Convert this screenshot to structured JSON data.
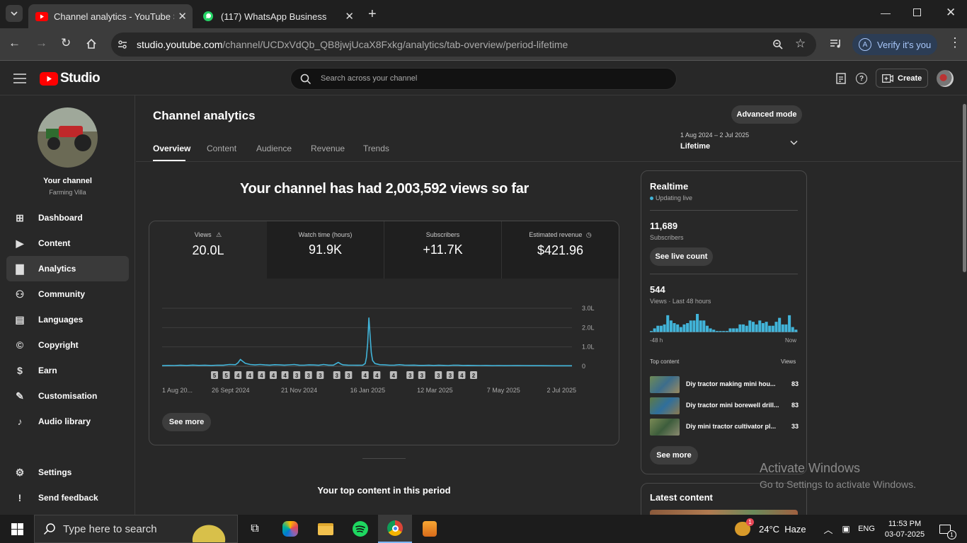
{
  "browser": {
    "tabs": [
      {
        "title": "Channel analytics - YouTube Stu",
        "active": true
      },
      {
        "title": "(117) WhatsApp Business",
        "active": false
      }
    ],
    "url_host": "studio.youtube.com",
    "url_path": "/channel/UCDxVdQb_QB8jwjUcaX8Fxkg/analytics/tab-overview/period-lifetime",
    "verify_label": "Verify it's you",
    "profile_letter": "A"
  },
  "header": {
    "logo_text": "Studio",
    "search_placeholder": "Search across your channel",
    "create_label": "Create"
  },
  "sidebar": {
    "channel_title": "Your channel",
    "channel_name": "Farming Villa",
    "items": [
      {
        "label": "Dashboard",
        "icon": "dashboard-icon",
        "active": false
      },
      {
        "label": "Content",
        "icon": "content-icon",
        "active": false
      },
      {
        "label": "Analytics",
        "icon": "analytics-icon",
        "active": true
      },
      {
        "label": "Community",
        "icon": "community-icon",
        "active": false
      },
      {
        "label": "Languages",
        "icon": "languages-icon",
        "active": false
      },
      {
        "label": "Copyright",
        "icon": "copyright-icon",
        "active": false
      },
      {
        "label": "Earn",
        "icon": "earn-icon",
        "active": false
      },
      {
        "label": "Customisation",
        "icon": "customisation-icon",
        "active": false
      },
      {
        "label": "Audio library",
        "icon": "audio-library-icon",
        "active": false
      }
    ],
    "bottom_items": [
      {
        "label": "Settings",
        "icon": "settings-icon"
      },
      {
        "label": "Send feedback",
        "icon": "feedback-icon"
      }
    ]
  },
  "main": {
    "page_title": "Channel analytics",
    "advanced_mode_label": "Advanced mode",
    "tabs": [
      "Overview",
      "Content",
      "Audience",
      "Revenue",
      "Trends"
    ],
    "active_tab": "Overview",
    "period": {
      "range": "1 Aug 2024 – 2 Jul 2025",
      "label": "Lifetime"
    },
    "headline": "Your channel has had 2,003,592 views so far",
    "metrics": [
      {
        "label": "Views",
        "value": "20.0L",
        "icon": "warning-icon"
      },
      {
        "label": "Watch time (hours)",
        "value": "91.9K",
        "icon": ""
      },
      {
        "label": "Subscribers",
        "value": "+11.7K",
        "icon": ""
      },
      {
        "label": "Estimated revenue",
        "value": "$421.96",
        "icon": "clock-icon"
      }
    ],
    "see_more_label": "See more",
    "top_content_heading": "Your top content in this period"
  },
  "chart_data": {
    "type": "line",
    "ylabel": "",
    "yticks": [
      "0",
      "1.0L",
      "2.0L",
      "3.0L"
    ],
    "ylim": [
      0,
      300000
    ],
    "xticks": [
      {
        "label": "1 Aug 20...",
        "day": 0
      },
      {
        "label": "26 Sept 2024",
        "day": 56
      },
      {
        "label": "21 Nov 2024",
        "day": 112
      },
      {
        "label": "16 Jan 2025",
        "day": 168
      },
      {
        "label": "12 Mar 2025",
        "day": 223
      },
      {
        "label": "7 May 2025",
        "day": 279
      },
      {
        "label": "2 Jul 2025",
        "day": 335
      }
    ],
    "series": [
      {
        "values": [
          [
            0,
            3000
          ],
          [
            5,
            4000
          ],
          [
            10,
            3500
          ],
          [
            15,
            5000
          ],
          [
            20,
            4000
          ],
          [
            25,
            6000
          ],
          [
            30,
            4500
          ],
          [
            35,
            5000
          ],
          [
            40,
            4000
          ],
          [
            45,
            5500
          ],
          [
            50,
            5000
          ],
          [
            55,
            9000
          ],
          [
            60,
            8000
          ],
          [
            62,
            18000
          ],
          [
            64,
            35000
          ],
          [
            66,
            25000
          ],
          [
            68,
            15000
          ],
          [
            72,
            9000
          ],
          [
            76,
            7000
          ],
          [
            80,
            9000
          ],
          [
            84,
            7000
          ],
          [
            88,
            6000
          ],
          [
            92,
            8000
          ],
          [
            96,
            7000
          ],
          [
            100,
            6000
          ],
          [
            104,
            7500
          ],
          [
            108,
            9000
          ],
          [
            112,
            6000
          ],
          [
            116,
            5500
          ],
          [
            120,
            7000
          ],
          [
            124,
            6500
          ],
          [
            128,
            5000
          ],
          [
            132,
            9000
          ],
          [
            136,
            6000
          ],
          [
            140,
            6000
          ],
          [
            144,
            20000
          ],
          [
            146,
            12000
          ],
          [
            148,
            7000
          ],
          [
            152,
            6000
          ],
          [
            156,
            5500
          ],
          [
            160,
            5000
          ],
          [
            164,
            6000
          ],
          [
            166,
            14000
          ],
          [
            167,
            45000
          ],
          [
            168,
            120000
          ],
          [
            169,
            250000
          ],
          [
            170,
            160000
          ],
          [
            171,
            70000
          ],
          [
            172,
            30000
          ],
          [
            174,
            14000
          ],
          [
            178,
            8000
          ],
          [
            182,
            7000
          ],
          [
            186,
            5500
          ],
          [
            190,
            6000
          ],
          [
            194,
            8000
          ],
          [
            198,
            6000
          ],
          [
            202,
            5000
          ],
          [
            206,
            6000
          ],
          [
            210,
            4500
          ],
          [
            214,
            4500
          ],
          [
            218,
            5000
          ],
          [
            222,
            4000
          ],
          [
            226,
            5000
          ],
          [
            230,
            4500
          ],
          [
            234,
            3500
          ],
          [
            238,
            5500
          ],
          [
            242,
            5000
          ],
          [
            246,
            4000
          ],
          [
            250,
            4500
          ],
          [
            255,
            4000
          ],
          [
            260,
            3500
          ],
          [
            265,
            4000
          ],
          [
            270,
            3000
          ],
          [
            275,
            3500
          ],
          [
            280,
            3000
          ],
          [
            290,
            3500
          ],
          [
            300,
            3000
          ],
          [
            310,
            3000
          ],
          [
            320,
            2500
          ],
          [
            335,
            2500
          ]
        ]
      }
    ],
    "markers": [
      "5",
      "5",
      "4",
      "4",
      "4",
      "4",
      "4",
      "3",
      "3",
      "3",
      "3",
      "3",
      "4",
      "4",
      "4",
      "3",
      "3",
      "3",
      "3",
      "4",
      "2"
    ],
    "grid": true
  },
  "realtime": {
    "title": "Realtime",
    "status": "Updating live",
    "subscribers_value": "11,689",
    "subscribers_label": "Subscribers",
    "see_live_count_label": "See live count",
    "views_value": "544",
    "views_label": "Views · Last 48 hours",
    "axis_start": "-48 h",
    "axis_end": "Now",
    "bars": [
      1,
      3,
      5,
      5,
      6,
      13,
      9,
      7,
      6,
      4,
      6,
      7,
      9,
      9,
      14,
      9,
      9,
      5,
      3,
      2,
      1,
      1,
      1,
      1,
      3,
      3,
      3,
      6,
      6,
      5,
      9,
      8,
      6,
      9,
      7,
      8,
      5,
      5,
      8,
      11,
      6,
      6,
      13,
      4,
      2
    ],
    "top_content_label": "Top content",
    "views_col_label": "Views",
    "top_content": [
      {
        "title": "Diy tractor making mini hou...",
        "views": "83"
      },
      {
        "title": "Diy tractor mini borewell drill...",
        "views": "83"
      },
      {
        "title": "Diy mini tractor cultivator pl...",
        "views": "33"
      }
    ],
    "see_more_label": "See more",
    "latest_content_title": "Latest content"
  },
  "watermark": {
    "line1": "Activate Windows",
    "line2": "Go to Settings to activate Windows."
  },
  "taskbar": {
    "search_placeholder": "Type here to search",
    "weather": "24°C  Haze",
    "weather_badge": "1",
    "language": "ENG",
    "time": "11:53 PM",
    "date": "03-07-2025",
    "notification_count": "1"
  }
}
